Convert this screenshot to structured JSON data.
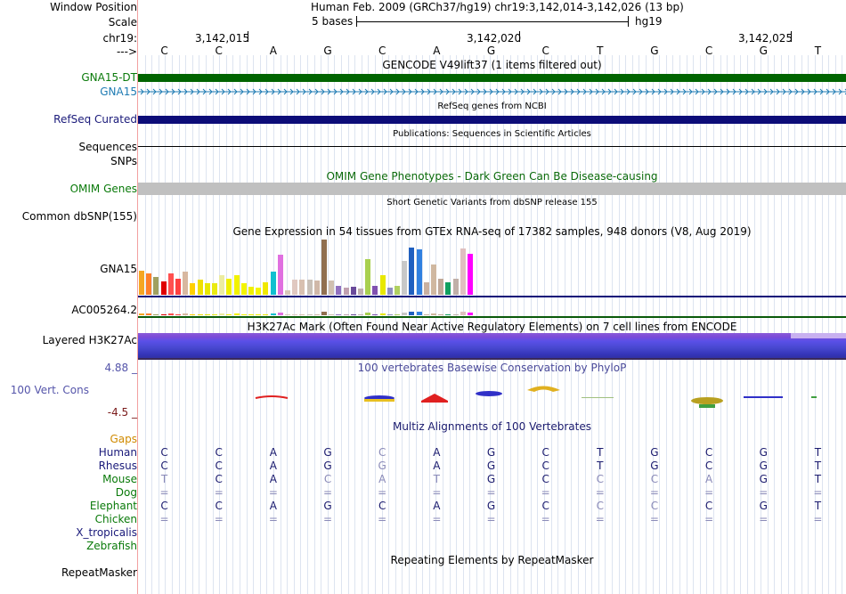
{
  "header": {
    "window_position_label": "Window Position",
    "window_position_value": "Human Feb. 2009 (GRCh37/hg19)   chr19:3,142,014-3,142,026 (13 bp)",
    "scale_label": "Scale",
    "scale_text": "5 bases",
    "scale_assembly": "hg19",
    "chrom_label": "chr19:",
    "coords": [
      "3,142,015",
      "3,142,020",
      "3,142,025"
    ],
    "strand_label": "--->"
  },
  "sequence": [
    "C",
    "C",
    "A",
    "G",
    "C",
    "A",
    "G",
    "C",
    "T",
    "G",
    "C",
    "G",
    "T"
  ],
  "tracks": {
    "gencode_title": "GENCODE V49lift37 (1 items filtered out)",
    "gencode_items": [
      "GNA15-DT",
      "GNA15"
    ],
    "refseq_title": "RefSeq genes from NCBI",
    "refseq_label": "RefSeq Curated",
    "pubs_title": "Publications: Sequences in Scientific Articles",
    "pubs_label": "Sequences",
    "snps_label": "SNPs",
    "omim_title": "OMIM Gene Phenotypes - Dark Green Can Be Disease-causing",
    "omim_label": "OMIM Genes",
    "dbsnp_title": "Short Genetic Variants from dbSNP release 155",
    "dbsnp_label": "Common dbSNP(155)",
    "gtex_title": "Gene Expression in 54 tissues from GTEx RNA-seq of 17382 samples, 948 donors (V8, Aug 2019)",
    "gtex_gene1": "GNA15",
    "gtex_gene2": "AC005264.2",
    "h3k27_title": "H3K27Ac Mark (Often Found Near Active Regulatory Elements) on 7 cell lines from ENCODE",
    "h3k27_label": "Layered H3K27Ac",
    "cons_title": "100 vertebrates Basewise Conservation by PhyloP",
    "cons_label": "100 Vert. Cons",
    "cons_max": "4.88 _",
    "cons_min": "-4.5 _",
    "multiz_title": "Multiz Alignments of 100 Vertebrates",
    "gaps_label": "Gaps",
    "repeat_title": "Repeating Elements by RepeatMasker",
    "repeat_label": "RepeatMasker"
  },
  "gtex_values": [
    {
      "c": "#f5a623",
      "v": 27
    },
    {
      "c": "#ff7f2a",
      "v": 24
    },
    {
      "c": "#a0a060",
      "v": 20
    },
    {
      "c": "#e00000",
      "v": 15
    },
    {
      "c": "#ff5050",
      "v": 24
    },
    {
      "c": "#ff4040",
      "v": 18
    },
    {
      "c": "#d8b8a0",
      "v": 26
    },
    {
      "c": "#ffd000",
      "v": 13
    },
    {
      "c": "#f0e000",
      "v": 17
    },
    {
      "c": "#e8e800",
      "v": 13
    },
    {
      "c": "#eaea10",
      "v": 13
    },
    {
      "c": "#ececa0",
      "v": 22
    },
    {
      "c": "#f0f000",
      "v": 18
    },
    {
      "c": "#f2f200",
      "v": 22
    },
    {
      "c": "#f4f400",
      "v": 13
    },
    {
      "c": "#f0f000",
      "v": 9
    },
    {
      "c": "#f5f500",
      "v": 8
    },
    {
      "c": "#f0e800",
      "v": 14
    },
    {
      "c": "#10c0d0",
      "v": 26
    },
    {
      "c": "#e070e0",
      "v": 45
    },
    {
      "c": "#d8c8b8",
      "v": 5
    },
    {
      "c": "#e0c8c0",
      "v": 17
    },
    {
      "c": "#d8c0b0",
      "v": 17
    },
    {
      "c": "#c8c0b8",
      "v": 17
    },
    {
      "c": "#d0b8a8",
      "v": 16
    },
    {
      "c": "#907050",
      "v": 62
    },
    {
      "c": "#d0c0b0",
      "v": 16
    },
    {
      "c": "#9070c0",
      "v": 10
    },
    {
      "c": "#c0a0b0",
      "v": 8
    },
    {
      "c": "#6a4a9a",
      "v": 9
    },
    {
      "c": "#c0b0b0",
      "v": 7
    },
    {
      "c": "#a8d050",
      "v": 40
    },
    {
      "c": "#8050b0",
      "v": 10
    },
    {
      "c": "#e8e800",
      "v": 22
    },
    {
      "c": "#9090c0",
      "v": 8
    },
    {
      "c": "#b0d060",
      "v": 10
    },
    {
      "c": "#c8c8c8",
      "v": 38
    },
    {
      "c": "#2060c0",
      "v": 53
    },
    {
      "c": "#3080e0",
      "v": 51
    },
    {
      "c": "#c8b0a0",
      "v": 14
    },
    {
      "c": "#d0b8a0",
      "v": 34
    },
    {
      "c": "#c0a898",
      "v": 18
    },
    {
      "c": "#10a060",
      "v": 14
    },
    {
      "c": "#c0b0a8",
      "v": 18
    },
    {
      "c": "#e0c0c0",
      "v": 52
    },
    {
      "c": "#ff00ff",
      "v": 46
    }
  ],
  "multiz": {
    "species": [
      "Human",
      "Rhesus",
      "Mouse",
      "Dog",
      "Elephant",
      "Chicken",
      "X_tropicalis",
      "Zebrafish"
    ],
    "rows": [
      [
        "C",
        "C",
        "A",
        "G",
        "C",
        "A",
        "G",
        "C",
        "T",
        "G",
        "C",
        "G",
        "T"
      ],
      [
        "C",
        "C",
        "A",
        "G",
        "G",
        "A",
        "G",
        "C",
        "T",
        "G",
        "C",
        "G",
        "T"
      ],
      [
        "T",
        "C",
        "A",
        "C",
        "A",
        "T",
        "G",
        "C",
        "C",
        "C",
        "A",
        "G",
        "T"
      ],
      [
        "=",
        "=",
        "=",
        "=",
        "=",
        "=",
        "=",
        "=",
        "=",
        "=",
        "=",
        "=",
        "="
      ],
      [
        "C",
        "C",
        "A",
        "G",
        "C",
        "A",
        "G",
        "C",
        "C",
        "C",
        "C",
        "G",
        "T"
      ],
      [
        "=",
        "=",
        "=",
        "=",
        "=",
        "=",
        "=",
        "=",
        "=",
        "=",
        "=",
        "=",
        "="
      ],
      [],
      []
    ],
    "highlight_rows": [
      [
        0,
        1,
        2,
        3,
        5,
        6,
        7,
        8,
        9,
        10,
        11,
        12
      ],
      [
        0,
        1,
        2,
        3,
        5,
        6,
        7,
        8,
        9,
        10,
        11,
        12
      ],
      [
        1,
        2,
        6,
        7,
        11,
        12
      ],
      [],
      [
        0,
        1,
        2,
        3,
        4,
        5,
        6,
        7,
        10,
        11,
        12
      ],
      [],
      [],
      []
    ]
  },
  "colors": {
    "gencode_dt": "#006400",
    "gencode": "#1e7bb3",
    "refseq": "#0c0c78",
    "omim": "#c0c0c0",
    "h3k27": "#5a5ae0",
    "base_dark": "#1a1a6e",
    "base_light": "#8a8ab8"
  }
}
